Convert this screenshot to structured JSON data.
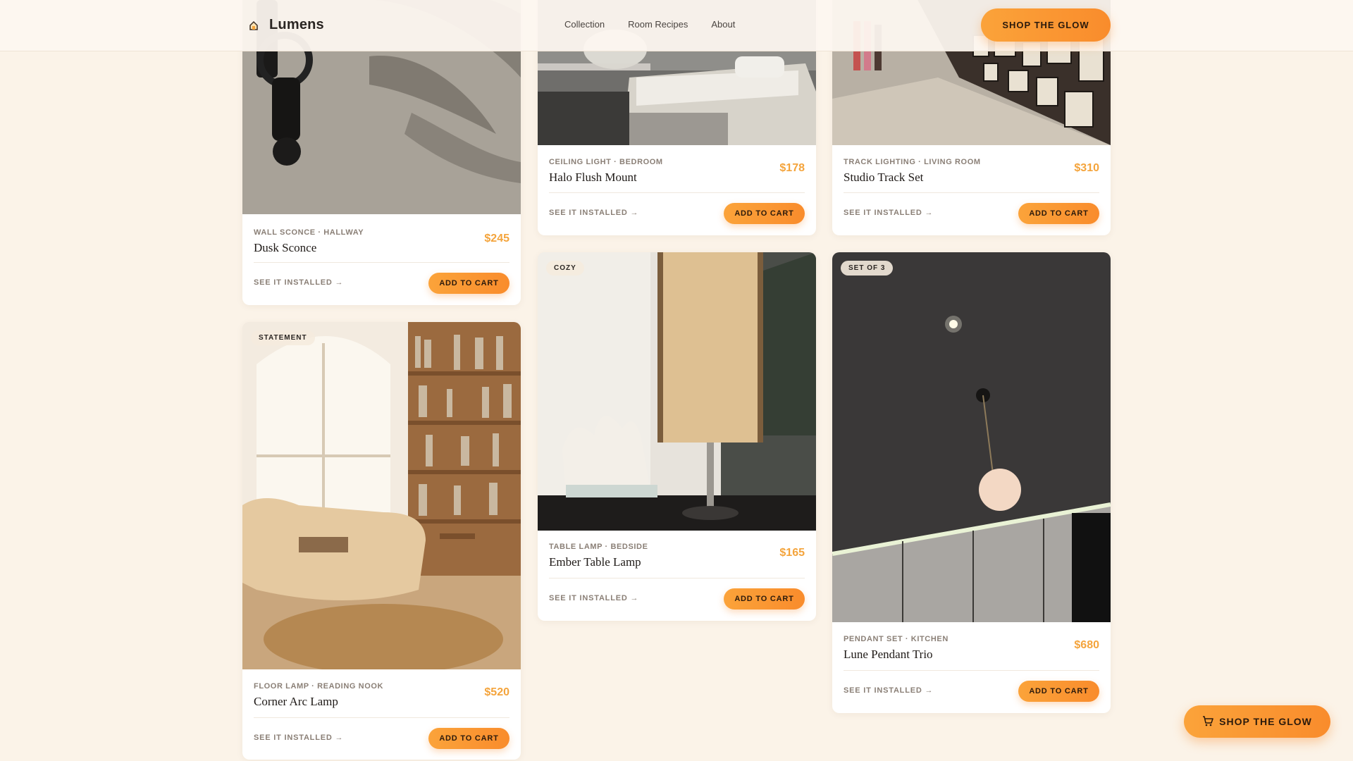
{
  "brand": {
    "name": "Lumens",
    "icon": "lamp-icon"
  },
  "nav": {
    "items": [
      "Collection",
      "Room Recipes",
      "About"
    ]
  },
  "header": {
    "cta": "SHOP THE GLOW"
  },
  "floating_cta": {
    "label": "SHOP THE GLOW",
    "icon": "cart-icon"
  },
  "colors": {
    "accent": "#f98c2c",
    "price": "#f4a43c",
    "background": "#fbf3e8"
  },
  "products": [
    {
      "meta": "WALL SCONCE · HALLWAY",
      "name": "Dusk Sconce",
      "price": "$245",
      "badge": "",
      "see": "SEE IT INSTALLED →",
      "cart": "ADD TO CART"
    },
    {
      "meta": "CEILING LIGHT · BEDROOM",
      "name": "Halo Flush Mount",
      "price": "$178",
      "badge": "",
      "see": "SEE IT INSTALLED →",
      "cart": "ADD TO CART"
    },
    {
      "meta": "TRACK LIGHTING · LIVING ROOM",
      "name": "Studio Track Set",
      "price": "$310",
      "badge": "",
      "see": "SEE IT INSTALLED →",
      "cart": "ADD TO CART"
    },
    {
      "meta": "FLOOR LAMP · READING NOOK",
      "name": "Corner Arc Lamp",
      "price": "$520",
      "badge": "STATEMENT",
      "see": "SEE IT INSTALLED →",
      "cart": "ADD TO CART"
    },
    {
      "meta": "TABLE LAMP · BEDSIDE",
      "name": "Ember Table Lamp",
      "price": "$165",
      "badge": "COZY",
      "see": "SEE IT INSTALLED →",
      "cart": "ADD TO CART"
    },
    {
      "meta": "PENDANT SET · KITCHEN",
      "name": "Lune Pendant Trio",
      "price": "$680",
      "badge": "SET OF 3",
      "see": "SEE IT INSTALLED →",
      "cart": "ADD TO CART"
    }
  ]
}
